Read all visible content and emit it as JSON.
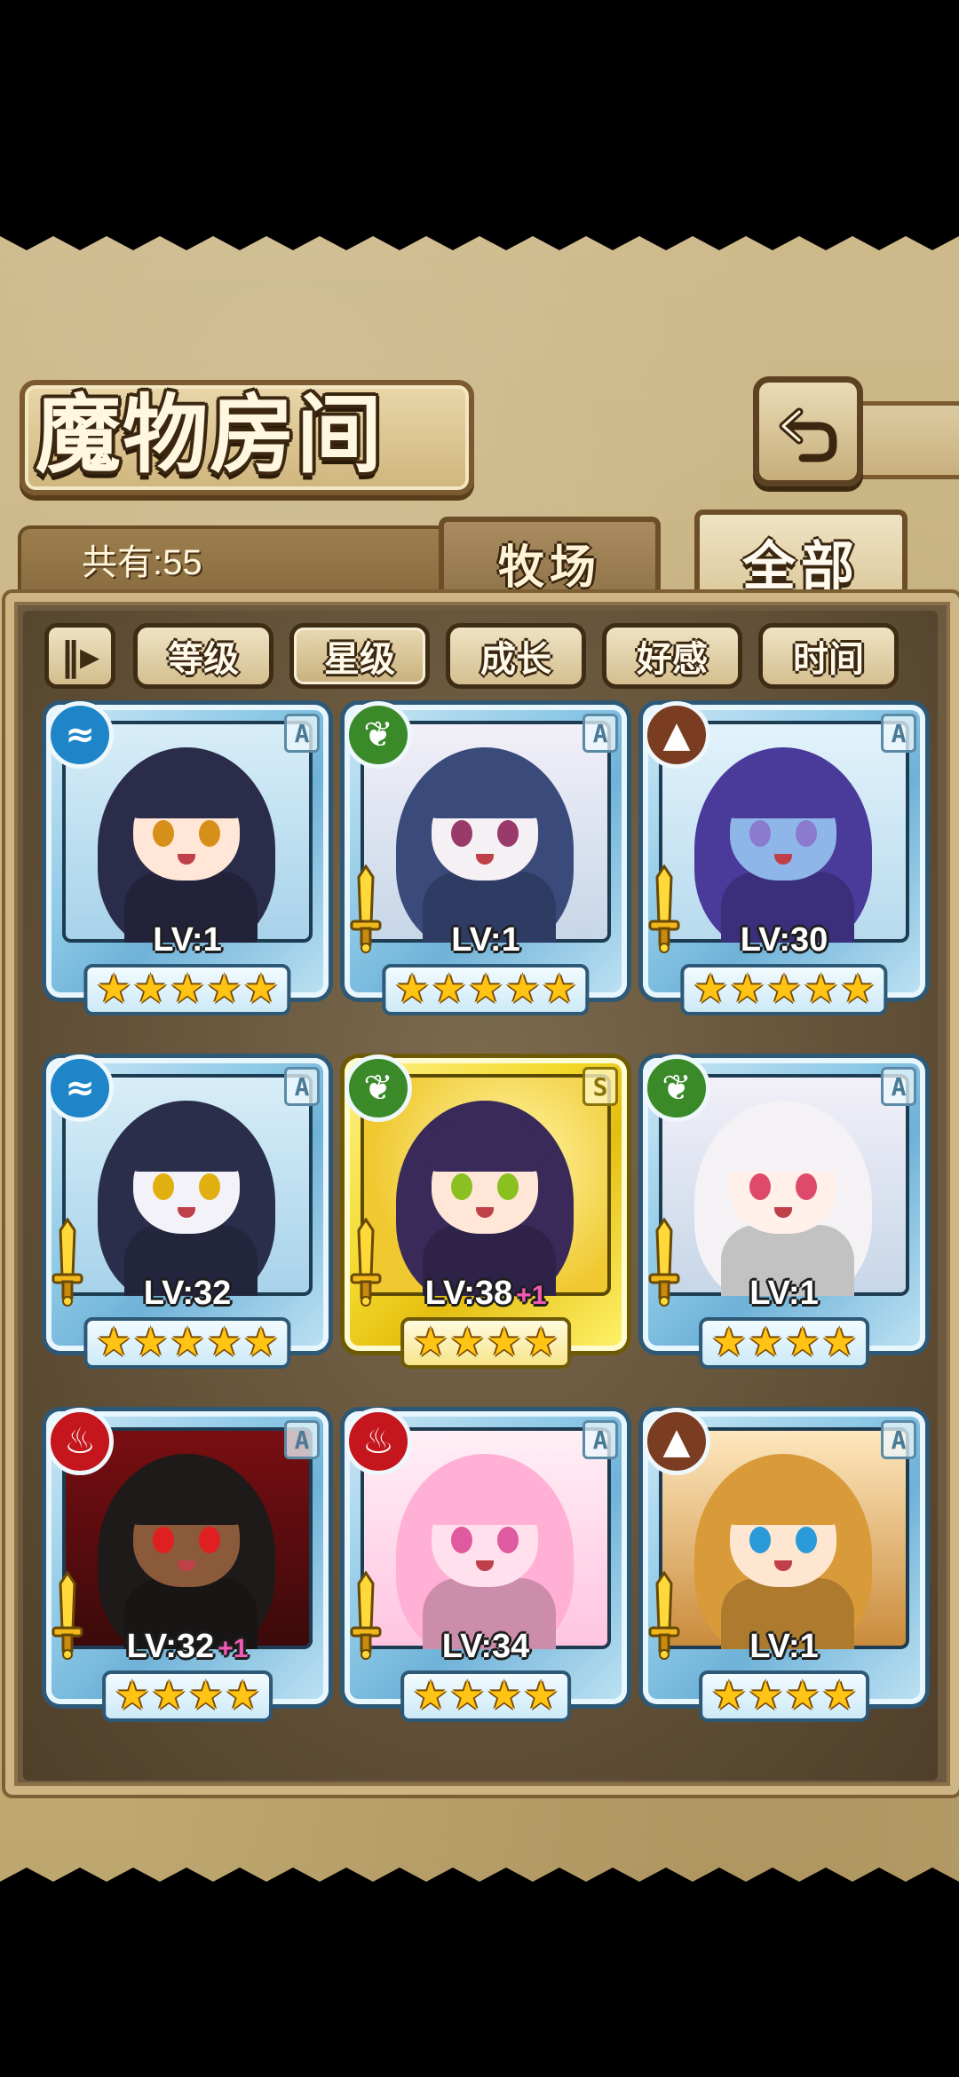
{
  "screen": {
    "title": "魔物房间",
    "count_label": "共有:55"
  },
  "tabs": [
    {
      "label": "牧场",
      "active": false
    },
    {
      "label": "全部",
      "active": true
    }
  ],
  "sort_toggle_icon": "sort-order-icon",
  "filters": [
    {
      "label": "等级",
      "active": false
    },
    {
      "label": "星级",
      "active": true
    },
    {
      "label": "成长",
      "active": false
    },
    {
      "label": "好感",
      "active": false
    },
    {
      "label": "时间",
      "active": false
    }
  ],
  "monsters": [
    {
      "element": "water",
      "rank": "A",
      "level": "LV:1",
      "plus": "",
      "stars": 5,
      "weapon": false,
      "frame": "blue"
    },
    {
      "element": "wood",
      "rank": "A",
      "level": "LV:1",
      "plus": "",
      "stars": 5,
      "weapon": true,
      "frame": "blue"
    },
    {
      "element": "earth",
      "rank": "A",
      "level": "LV:30",
      "plus": "",
      "stars": 5,
      "weapon": true,
      "frame": "blue"
    },
    {
      "element": "water",
      "rank": "A",
      "level": "LV:32",
      "plus": "",
      "stars": 5,
      "weapon": true,
      "frame": "blue"
    },
    {
      "element": "wood",
      "rank": "S",
      "level": "LV:38",
      "plus": "+1",
      "stars": 4,
      "weapon": true,
      "frame": "gold"
    },
    {
      "element": "wood",
      "rank": "A",
      "level": "LV:1",
      "plus": "",
      "stars": 4,
      "weapon": true,
      "frame": "blue"
    },
    {
      "element": "fire",
      "rank": "A",
      "level": "LV:32",
      "plus": "+1",
      "stars": 4,
      "weapon": true,
      "frame": "blue"
    },
    {
      "element": "fire",
      "rank": "A",
      "level": "LV:34",
      "plus": "",
      "stars": 4,
      "weapon": true,
      "frame": "blue"
    },
    {
      "element": "earth",
      "rank": "A",
      "level": "LV:1",
      "plus": "",
      "stars": 4,
      "weapon": true,
      "frame": "blue"
    }
  ],
  "colors": {
    "water": "#1e86c8",
    "wood": "#3a8a2a",
    "earth": "#7a3d22",
    "fire": "#c4161c",
    "plus_text": "#f05ab4",
    "star": "#ffc414"
  }
}
